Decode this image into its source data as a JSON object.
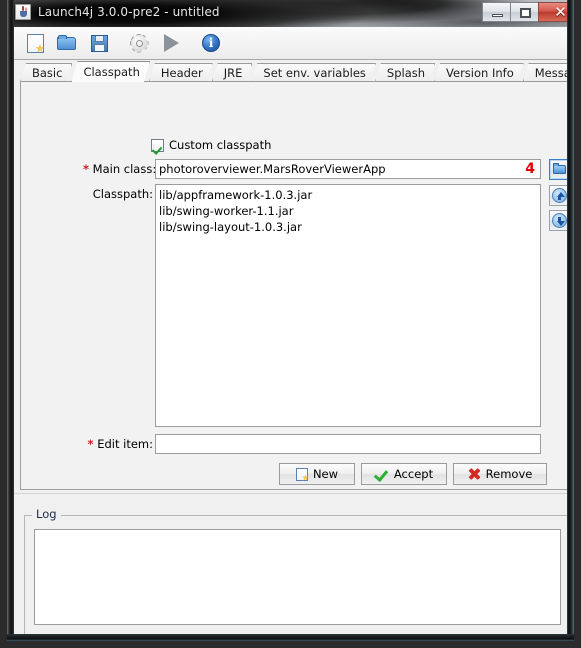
{
  "window": {
    "title": "Launch4j 3.0.0-pre2 - untitled",
    "app_icon": "java-icon",
    "controls": {
      "minimize": "minimize-icon",
      "maximize": "maximize-icon",
      "close": "✕"
    }
  },
  "toolbar": {
    "buttons": [
      {
        "name": "new-config-button",
        "icon": "new-file-icon"
      },
      {
        "name": "open-config-button",
        "icon": "open-folder-icon"
      },
      {
        "name": "save-config-button",
        "icon": "save-disk-icon"
      },
      {
        "name": "build-settings-button",
        "icon": "gear-icon"
      },
      {
        "name": "run-button",
        "icon": "play-icon"
      },
      {
        "name": "about-button",
        "icon": "info-icon"
      }
    ]
  },
  "tabs": [
    {
      "label": "Basic",
      "active": false
    },
    {
      "label": "Classpath",
      "active": true
    },
    {
      "label": "Header",
      "active": false
    },
    {
      "label": "JRE",
      "active": false
    },
    {
      "label": "Set env. variables",
      "active": false
    },
    {
      "label": "Splash",
      "active": false
    },
    {
      "label": "Version Info",
      "active": false
    },
    {
      "label": "Messages",
      "active": false
    }
  ],
  "classpath_tab": {
    "custom_classpath": {
      "label": "Custom classpath",
      "checked": true
    },
    "main_class": {
      "label": "Main class:",
      "required_marker": "*",
      "value": "photoroverviewer.MarsRoverViewerApp",
      "annotation": "4",
      "annotation_color": "#e00000",
      "browse_button": "browse-main-class-button"
    },
    "classpath": {
      "label": "Classpath:",
      "items": [
        "lib/appframework-1.0.3.jar",
        "lib/swing-worker-1.1.jar",
        "lib/swing-layout-1.0.3.jar"
      ],
      "move_up_button": "move-up-button",
      "move_down_button": "move-down-button"
    },
    "edit_item": {
      "label": "Edit item:",
      "required_marker": "*",
      "value": "",
      "placeholder": ""
    },
    "buttons": {
      "new": "New",
      "accept": "Accept",
      "remove": "Remove"
    }
  },
  "log": {
    "title": "Log",
    "content": ""
  }
}
